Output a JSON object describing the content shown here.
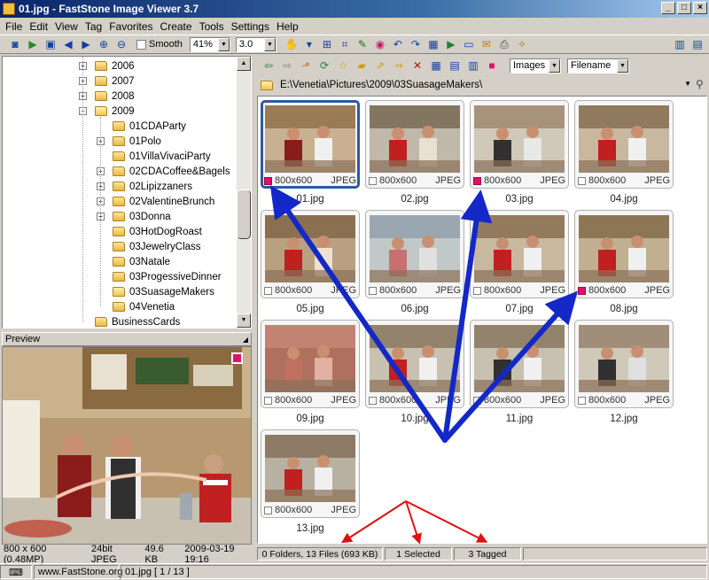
{
  "window": {
    "title": "01.jpg  -  FastStone Image Viewer 3.7",
    "controls": [
      "_",
      "□",
      "×"
    ]
  },
  "menu": [
    "File",
    "Edit",
    "View",
    "Tag",
    "Favorites",
    "Create",
    "Tools",
    "Settings",
    "Help"
  ],
  "toolbar": {
    "smooth_label": "Smooth",
    "zoom_value": "41%",
    "gamma_value": "3.0"
  },
  "tree": {
    "items": [
      {
        "label": "2006",
        "expander": "+"
      },
      {
        "label": "2007",
        "expander": "+"
      },
      {
        "label": "2008",
        "expander": "+"
      },
      {
        "label": "2009",
        "expander": "−"
      },
      {
        "label": "01CDAParty",
        "expander": ""
      },
      {
        "label": "01Polo",
        "expander": "+"
      },
      {
        "label": "01VillaVivaciParty",
        "expander": ""
      },
      {
        "label": "02CDACoffee&Bagels",
        "expander": "+"
      },
      {
        "label": "02Lipizzaners",
        "expander": "+"
      },
      {
        "label": "02ValentineBrunch",
        "expander": "+"
      },
      {
        "label": "03Donna",
        "expander": "+"
      },
      {
        "label": "03HotDogRoast",
        "expander": ""
      },
      {
        "label": "03JewelryClass",
        "expander": ""
      },
      {
        "label": "03Natale",
        "expander": ""
      },
      {
        "label": "03ProgessiveDinner",
        "expander": ""
      },
      {
        "label": "03SuasageMakers",
        "expander": ""
      },
      {
        "label": "04Venetia",
        "expander": ""
      },
      {
        "label": "BusinessCards",
        "expander": ""
      }
    ]
  },
  "preview": {
    "title": "Preview",
    "info": [
      "800 x 600 (0.48MP)",
      "24bit JPEG",
      "49.6 KB",
      "2009-03-19 19:16"
    ]
  },
  "browser": {
    "filter_value": "Images",
    "sort_value": "Filename",
    "path": "E:\\Venetia\\Pictures\\2009\\03SuasageMakers\\",
    "thumbnails": [
      {
        "name": "01.jpg",
        "dims": "800x600",
        "type": "JPEG",
        "tagged": true,
        "selected": true
      },
      {
        "name": "02.jpg",
        "dims": "800x600",
        "type": "JPEG",
        "tagged": false,
        "selected": false
      },
      {
        "name": "03.jpg",
        "dims": "800x600",
        "type": "JPEG",
        "tagged": true,
        "selected": false
      },
      {
        "name": "04.jpg",
        "dims": "800x600",
        "type": "JPEG",
        "tagged": false,
        "selected": false
      },
      {
        "name": "05.jpg",
        "dims": "800x600",
        "type": "JPEG",
        "tagged": false,
        "selected": false
      },
      {
        "name": "06.jpg",
        "dims": "800x600",
        "type": "JPEG",
        "tagged": false,
        "selected": false
      },
      {
        "name": "07.jpg",
        "dims": "800x600",
        "type": "JPEG",
        "tagged": false,
        "selected": false
      },
      {
        "name": "08.jpg",
        "dims": "800x600",
        "type": "JPEG",
        "tagged": true,
        "selected": false
      },
      {
        "name": "09.jpg",
        "dims": "800x600",
        "type": "JPEG",
        "tagged": false,
        "selected": false
      },
      {
        "name": "10.jpg",
        "dims": "800x600",
        "type": "JPEG",
        "tagged": false,
        "selected": false
      },
      {
        "name": "11.jpg",
        "dims": "800x600",
        "type": "JPEG",
        "tagged": false,
        "selected": false
      },
      {
        "name": "12.jpg",
        "dims": "800x600",
        "type": "JPEG",
        "tagged": false,
        "selected": false
      },
      {
        "name": "13.jpg",
        "dims": "800x600",
        "type": "JPEG",
        "tagged": false,
        "selected": false
      }
    ]
  },
  "status": {
    "files": "0 Folders, 13 Files (693 KB)",
    "selected": "1 Selected",
    "tagged": "3 Tagged"
  },
  "bottom": {
    "site": "www.FastStone.org",
    "position": "01.jpg [ 1 / 13 ]"
  },
  "colors": {
    "tag": "#e0106a",
    "selection": "#3058a0",
    "arrow_blue": "#1428c8",
    "arrow_red": "#e01010"
  }
}
